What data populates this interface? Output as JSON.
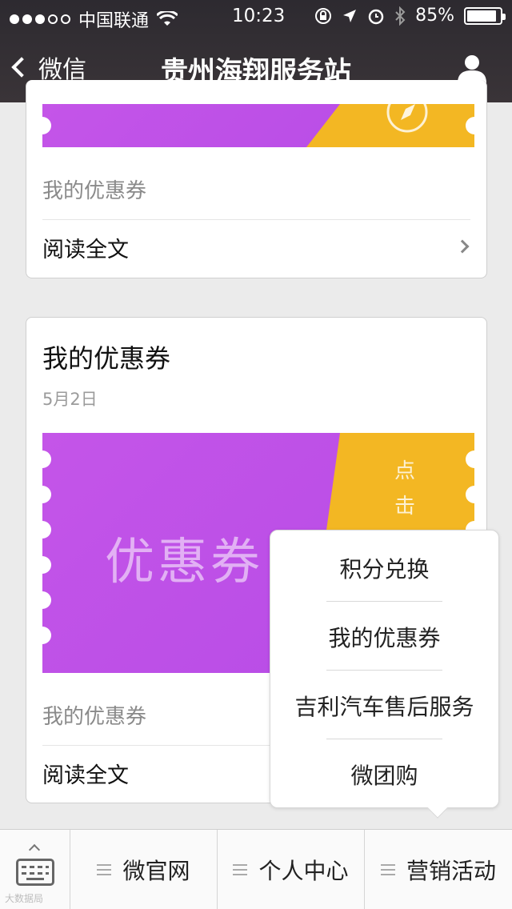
{
  "status_bar": {
    "carrier": "中国联通",
    "time": "10:23",
    "battery": "85%",
    "battery_level": 0.85,
    "signal_bars_filled": 3,
    "signal_bars_total": 5
  },
  "nav": {
    "back_label": "微信",
    "title": "贵州海翔服务站"
  },
  "card1": {
    "description": "我的优惠券",
    "read_more": "阅读全文"
  },
  "card2": {
    "title": "我的优惠券",
    "date": "5月2日",
    "coupon_word": "优惠券",
    "coupon_click": "点击",
    "description": "我的优惠券",
    "read_more": "阅读全文"
  },
  "popup_menu": {
    "items": [
      "积分兑换",
      "我的优惠券",
      "吉利汽车售后服务",
      "微团购"
    ]
  },
  "bottom_menu": {
    "tabs": [
      "微官网",
      "个人中心",
      "营销活动"
    ]
  },
  "watermark": "大数据局",
  "colors": {
    "coupon_purple": "#c455e8",
    "coupon_yellow": "#f3b723",
    "nav_bg": "#2d2a30"
  },
  "icons": {
    "back": "chevron-left-icon",
    "user": "user-icon",
    "keyboard": "keyboard-icon",
    "menu": "hamburger-icon",
    "wifi": "wifi-icon",
    "battery": "battery-icon"
  }
}
